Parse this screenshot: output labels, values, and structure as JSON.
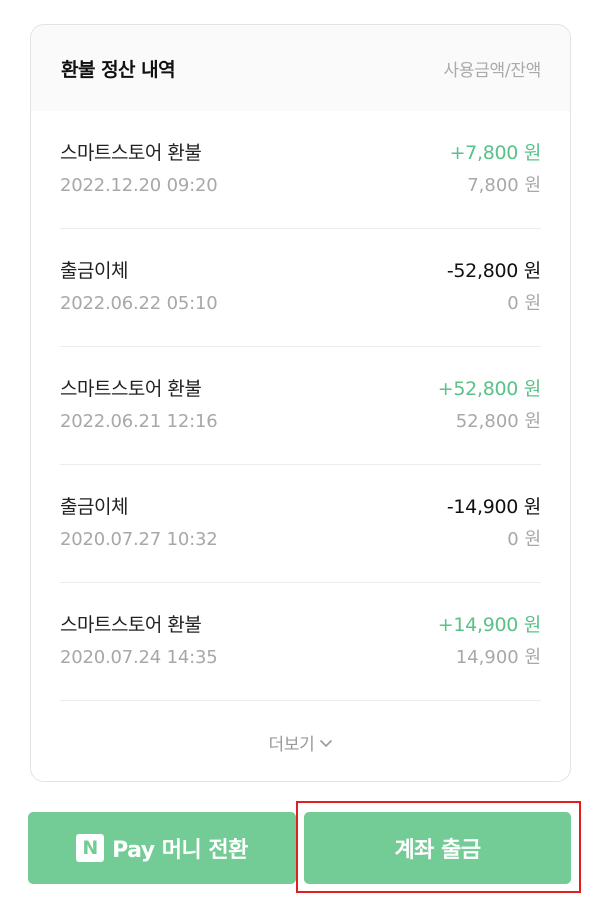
{
  "card": {
    "title": "환불 정산 내역",
    "subtitle": "사용금액/잔액"
  },
  "transactions": [
    {
      "name": "스마트스토어 환불",
      "date": "2022.12.20 09:20",
      "amount": "+7,800 원",
      "balance": "7,800 원",
      "type": "plus"
    },
    {
      "name": "출금이체",
      "date": "2022.06.22 05:10",
      "amount": "-52,800 원",
      "balance": "0 원",
      "type": "minus"
    },
    {
      "name": "스마트스토어 환불",
      "date": "2022.06.21 12:16",
      "amount": "+52,800 원",
      "balance": "52,800 원",
      "type": "plus"
    },
    {
      "name": "출금이체",
      "date": "2020.07.27 10:32",
      "amount": "-14,900 원",
      "balance": "0 원",
      "type": "minus"
    },
    {
      "name": "스마트스토어 환불",
      "date": "2020.07.24 14:35",
      "amount": "+14,900 원",
      "balance": "14,900 원",
      "type": "plus"
    }
  ],
  "more_label": "더보기",
  "buttons": {
    "pay_logo": "N",
    "pay_label": "Pay 머니 전환",
    "withdraw_label": "계좌 출금"
  },
  "colors": {
    "accent": "#73cc95",
    "plus_amount": "#5ac189",
    "highlight": "#e02020"
  }
}
